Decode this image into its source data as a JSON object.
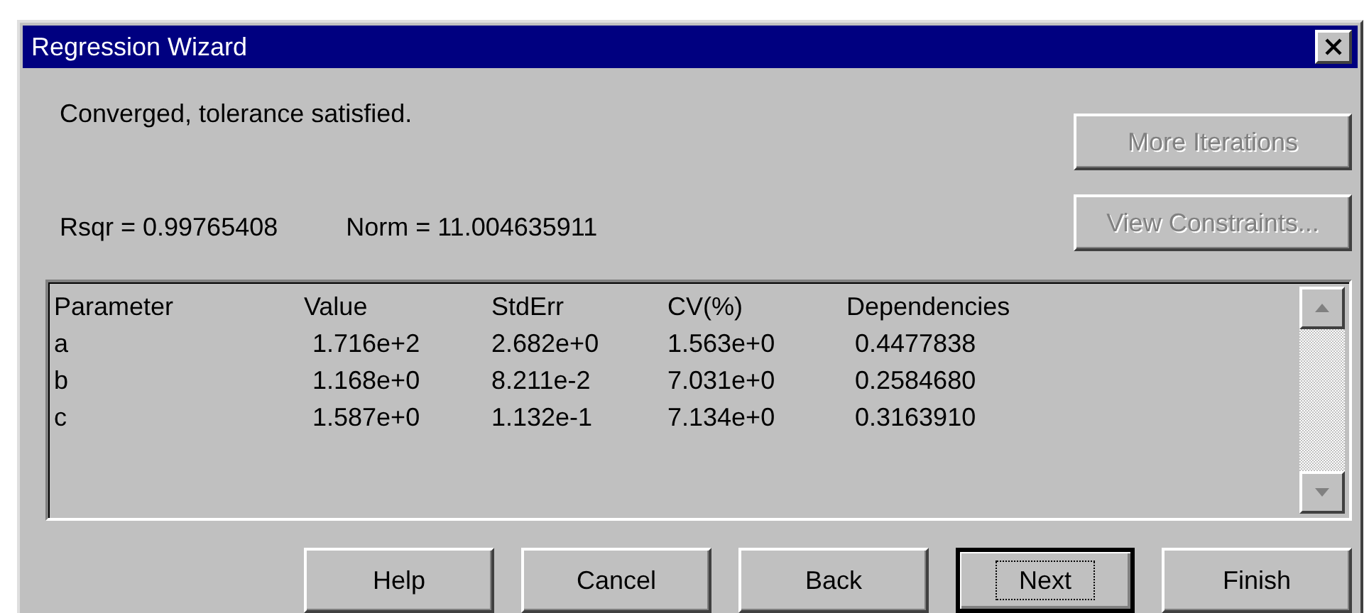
{
  "window": {
    "title": "Regression Wizard"
  },
  "status_message": "Converged, tolerance satisfied.",
  "statistics": [
    {
      "text": "Rsqr = 0.99765408"
    },
    {
      "text": "Norm = 11.004635911"
    }
  ],
  "side_buttons": [
    {
      "label": "More Iterations",
      "disabled": true
    },
    {
      "label": "View Constraints...",
      "disabled": true
    }
  ],
  "results": {
    "columns": [
      "Parameter",
      "Value",
      "StdErr",
      "CV(%)",
      "Dependencies"
    ],
    "rows": [
      [
        "a",
        "1.716e+2",
        "2.682e+0",
        "1.563e+0",
        "0.4477838"
      ],
      [
        "b",
        "1.168e+0",
        "8.211e-2",
        "7.031e+0",
        "0.2584680"
      ],
      [
        "c",
        "1.587e+0",
        "1.132e-1",
        "7.134e+0",
        "0.3163910"
      ]
    ]
  },
  "buttons": [
    {
      "label": "Help",
      "default": false
    },
    {
      "label": "Cancel",
      "default": false
    },
    {
      "label": "Back",
      "default": false
    },
    {
      "label": "Next",
      "default": true
    },
    {
      "label": "Finish",
      "default": false
    }
  ]
}
